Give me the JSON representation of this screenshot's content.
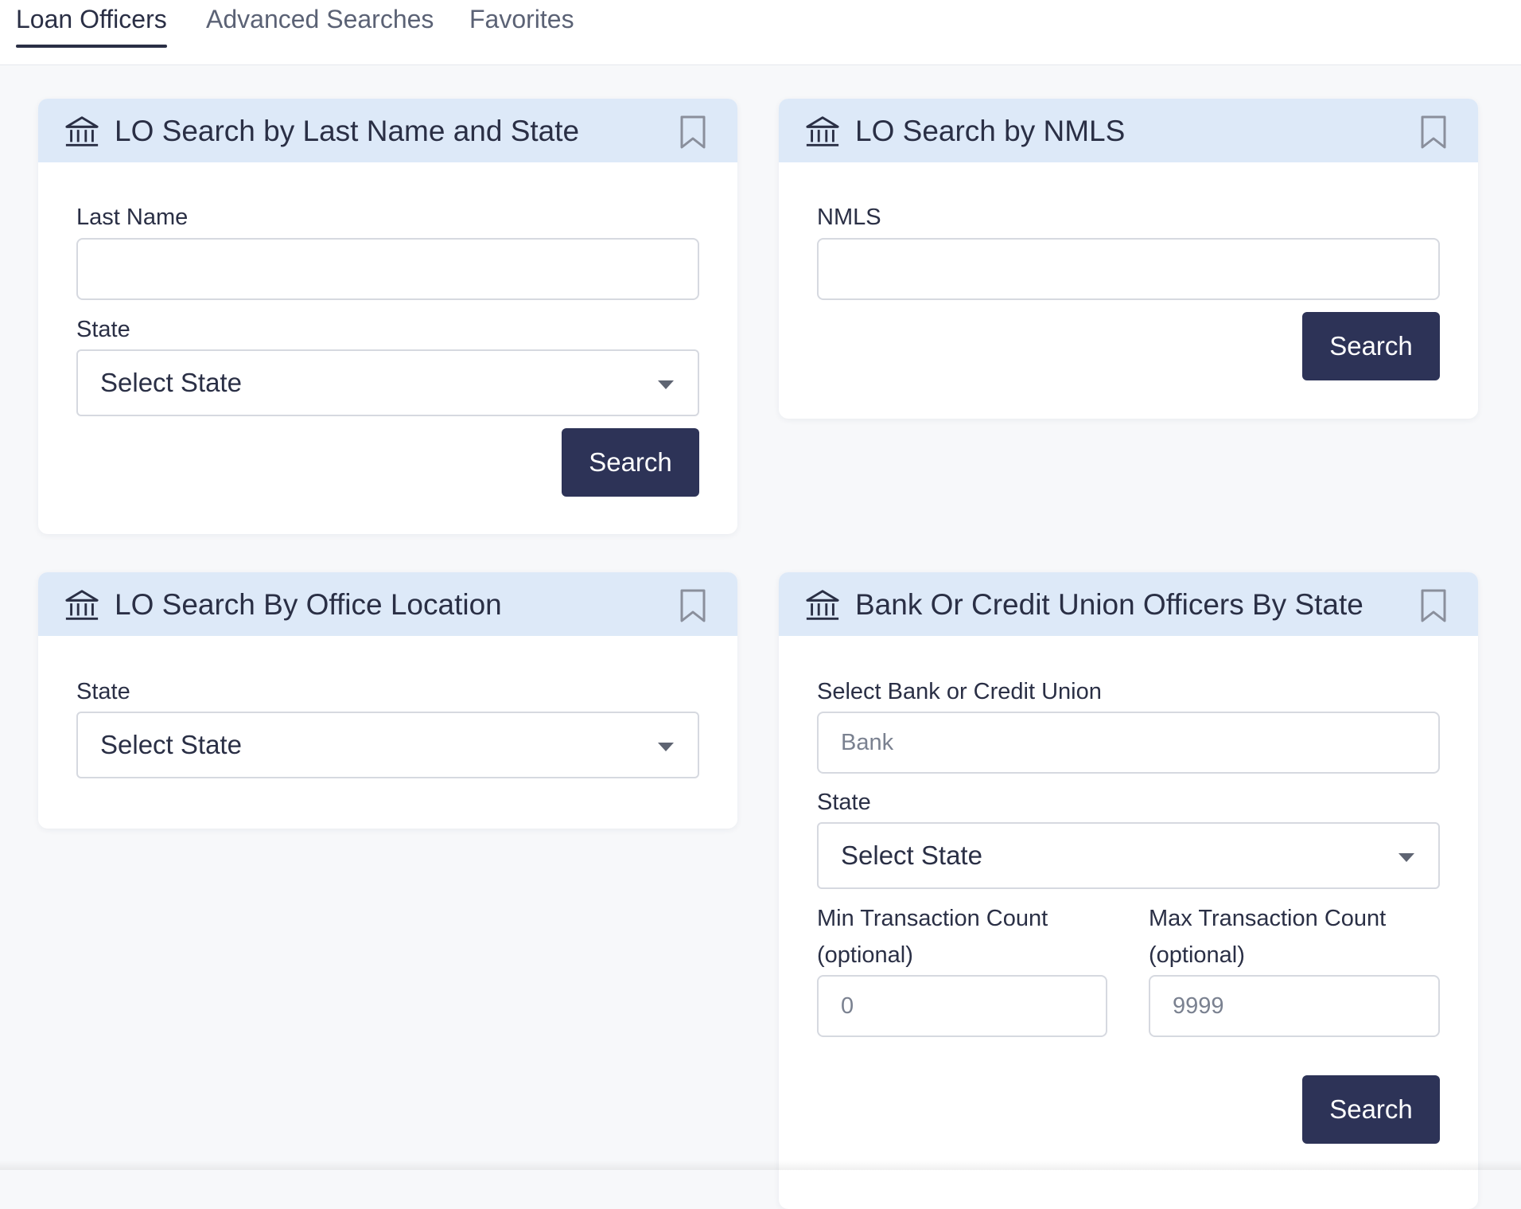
{
  "tabs": [
    {
      "label": "Loan Officers",
      "active": true
    },
    {
      "label": "Advanced Searches",
      "active": false
    },
    {
      "label": "Favorites",
      "active": false
    }
  ],
  "cards": {
    "last_name_state": {
      "icon": "bank-icon",
      "title": "LO Search by Last Name and State",
      "last_name_label": "Last Name",
      "last_name_value": "",
      "state_label": "State",
      "state_value": "Select State",
      "search_label": "Search"
    },
    "nmls": {
      "icon": "bank-icon",
      "title": "LO Search by NMLS",
      "nmls_label": "NMLS",
      "nmls_value": "",
      "search_label": "Search"
    },
    "office_location": {
      "icon": "bank-icon",
      "title": "LO Search By Office Location",
      "state_label": "State",
      "state_value": "Select State"
    },
    "bank_cu": {
      "icon": "bank-icon",
      "title": "Bank Or Credit Union Officers By State",
      "bank_label": "Select Bank or Credit Union",
      "bank_placeholder": "Bank",
      "state_label": "State",
      "state_value": "Select State",
      "min_label_1": "Min Transaction Count",
      "min_label_2": "(optional)",
      "min_placeholder": "0",
      "max_label_1": "Max Transaction Count",
      "max_label_2": "(optional)",
      "max_placeholder": "9999",
      "search_label": "Search"
    }
  },
  "colors": {
    "accent": "#2d3357",
    "card_header": "#dde9f8",
    "background": "#f7f8fa"
  }
}
